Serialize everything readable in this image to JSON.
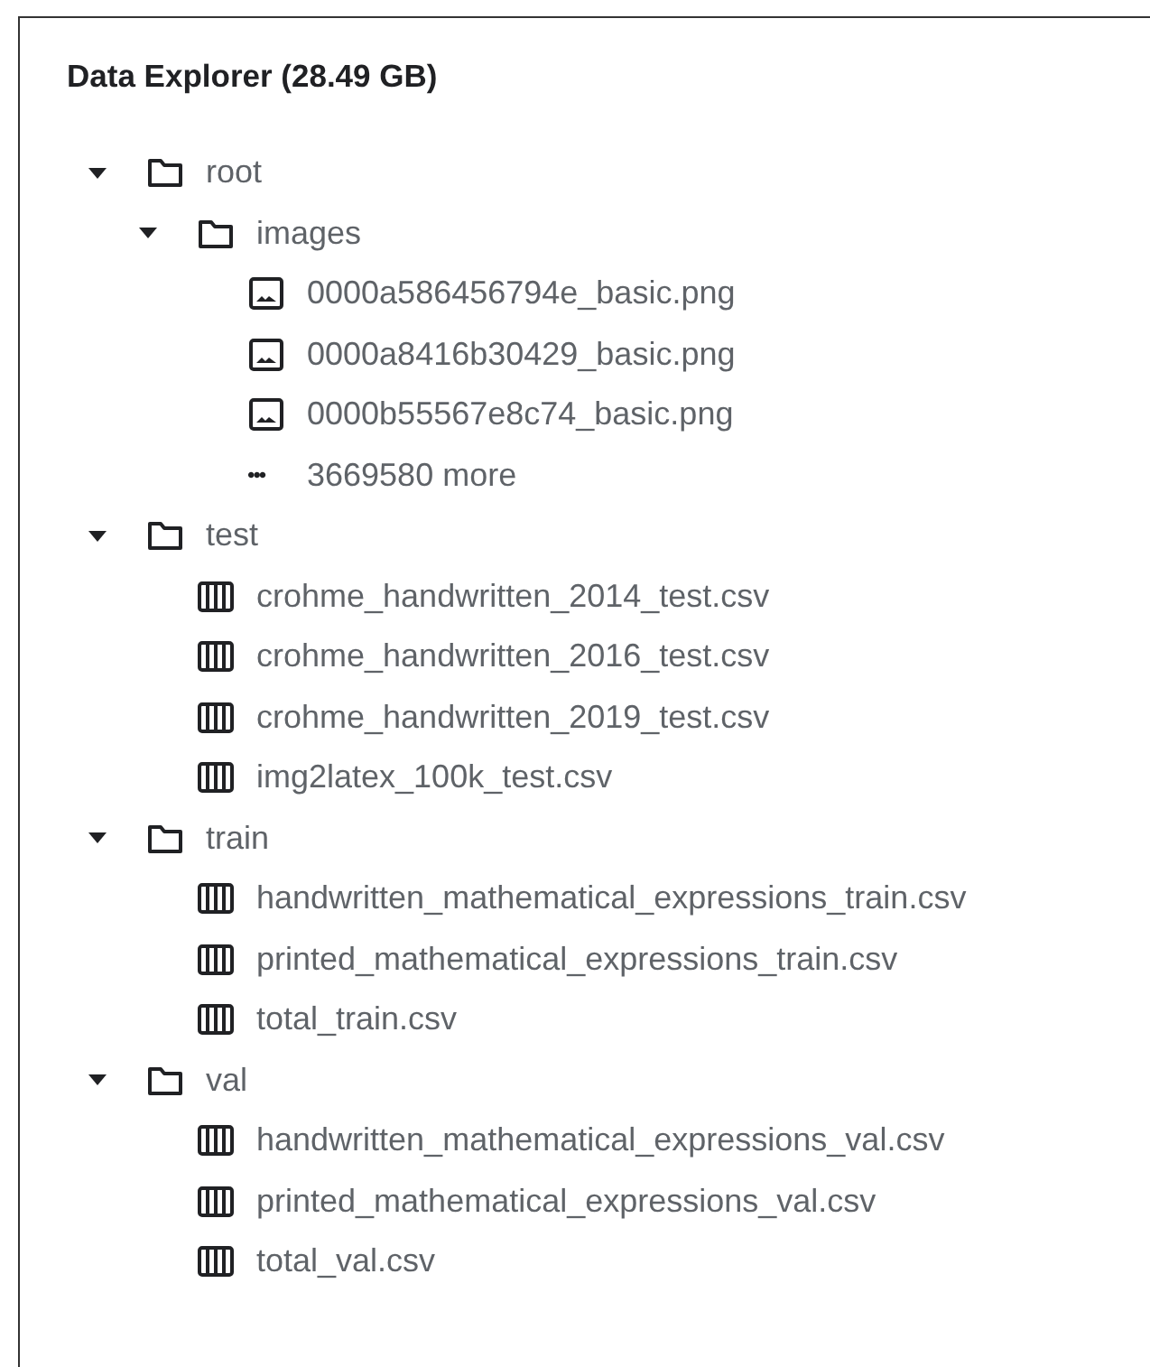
{
  "panel": {
    "title": "Data Explorer (28.49 GB)"
  },
  "tree": [
    {
      "kind": "folder",
      "name": "root",
      "expanded": true,
      "children": [
        {
          "kind": "folder",
          "name": "images",
          "expanded": true,
          "children": [
            {
              "kind": "image",
              "name": "0000a586456794e_basic.png"
            },
            {
              "kind": "image",
              "name": "0000a8416b30429_basic.png"
            },
            {
              "kind": "image",
              "name": "0000b55567e8c74_basic.png"
            },
            {
              "kind": "more",
              "icon": "•••",
              "name": "3669580 more"
            }
          ]
        }
      ]
    },
    {
      "kind": "folder",
      "name": "test",
      "expanded": true,
      "children": [
        {
          "kind": "table",
          "name": "crohme_handwritten_2014_test.csv"
        },
        {
          "kind": "table",
          "name": "crohme_handwritten_2016_test.csv"
        },
        {
          "kind": "table",
          "name": "crohme_handwritten_2019_test.csv"
        },
        {
          "kind": "table",
          "name": "img2latex_100k_test.csv"
        }
      ]
    },
    {
      "kind": "folder",
      "name": "train",
      "expanded": true,
      "children": [
        {
          "kind": "table",
          "name": "handwritten_mathematical_expressions_train.csv"
        },
        {
          "kind": "table",
          "name": "printed_mathematical_expressions_train.csv"
        },
        {
          "kind": "table",
          "name": "total_train.csv"
        }
      ]
    },
    {
      "kind": "folder",
      "name": "val",
      "expanded": true,
      "children": [
        {
          "kind": "table",
          "name": "handwritten_mathematical_expressions_val.csv"
        },
        {
          "kind": "table",
          "name": "printed_mathematical_expressions_val.csv"
        },
        {
          "kind": "table",
          "name": "total_val.csv"
        }
      ]
    }
  ]
}
